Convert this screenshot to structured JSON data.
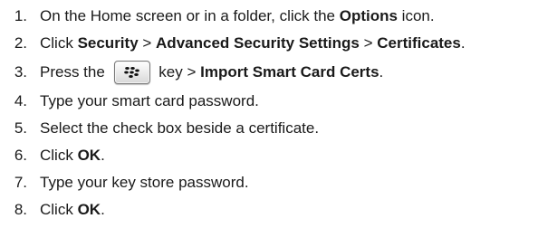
{
  "steps": [
    {
      "number": "1.",
      "parts": [
        "On the Home screen or in a folder, click the ",
        "Options",
        " icon."
      ]
    },
    {
      "number": "2.",
      "parts": [
        "Click ",
        "Security",
        " > ",
        "Advanced Security Settings",
        " > ",
        "Certificates",
        "."
      ]
    },
    {
      "number": "3.",
      "parts": [
        "Press the ",
        " key > ",
        "Import Smart Card Certs",
        "."
      ],
      "key_icon": "blackberry-menu-key-icon"
    },
    {
      "number": "4.",
      "parts": [
        "Type your smart card password."
      ]
    },
    {
      "number": "5.",
      "parts": [
        "Select the check box beside a certificate."
      ]
    },
    {
      "number": "6.",
      "parts": [
        "Click ",
        "OK",
        "."
      ]
    },
    {
      "number": "7.",
      "parts": [
        "Type your key store password."
      ]
    },
    {
      "number": "8.",
      "parts": [
        "Click ",
        "OK",
        "."
      ]
    }
  ]
}
